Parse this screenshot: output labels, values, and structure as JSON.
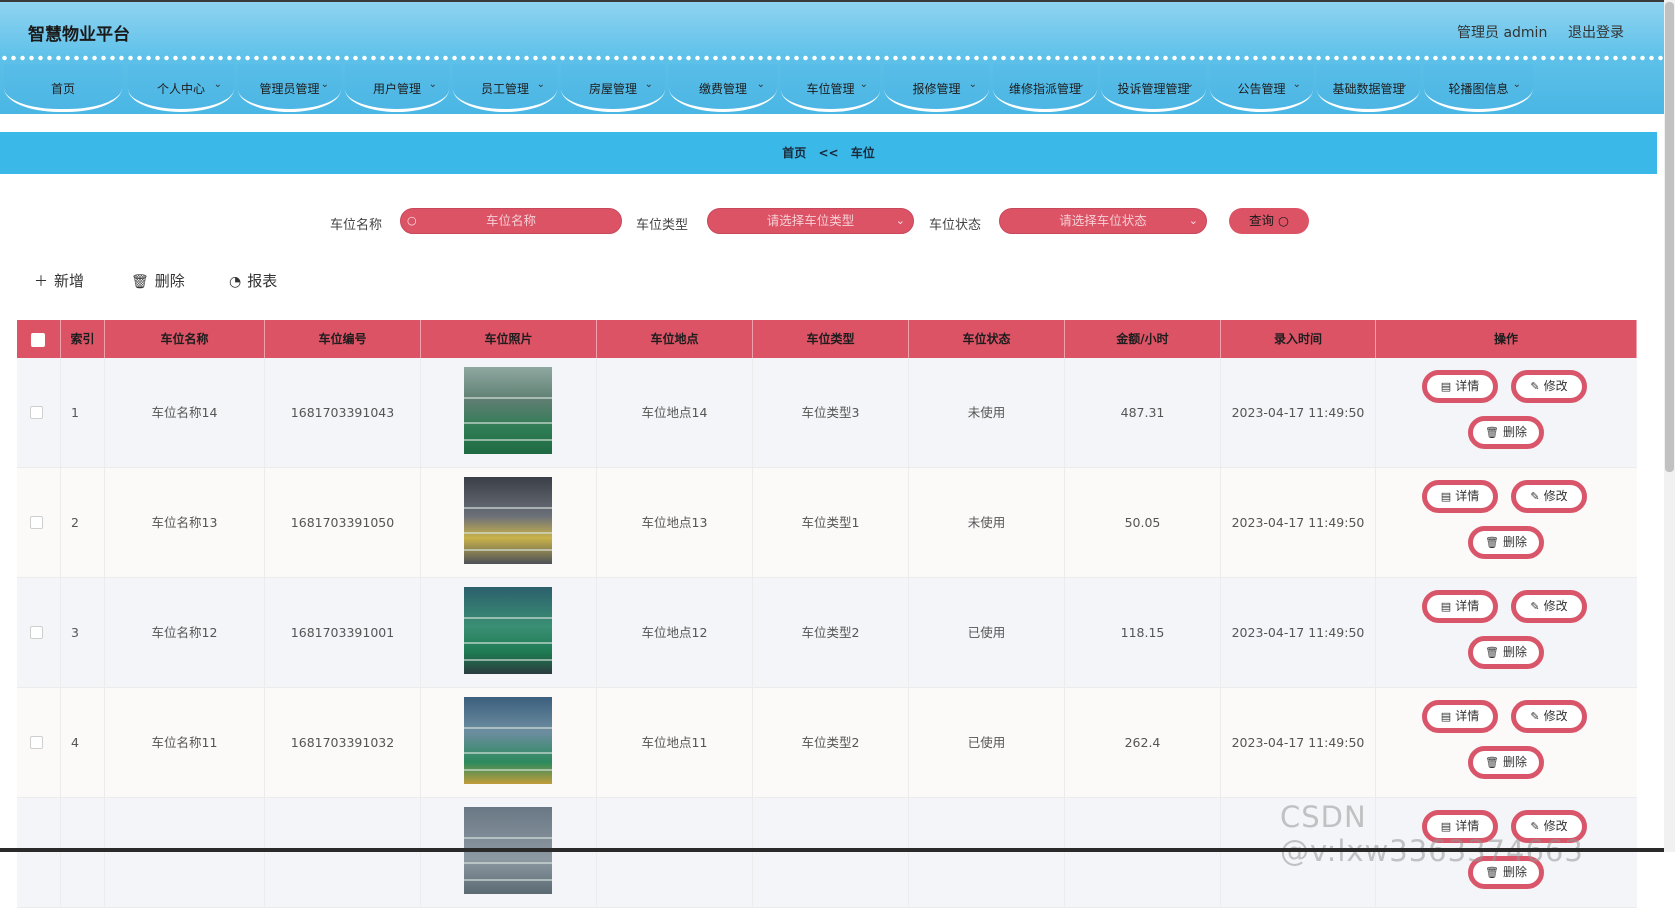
{
  "header": {
    "title": "智慧物业平台",
    "user_info": "管理员 admin",
    "logout": "退出登录"
  },
  "nav": [
    {
      "label": "首页",
      "dropdown": false
    },
    {
      "label": "个人中心",
      "dropdown": true
    },
    {
      "label": "管理员管理",
      "dropdown": true
    },
    {
      "label": "用户管理",
      "dropdown": true
    },
    {
      "label": "员工管理",
      "dropdown": true
    },
    {
      "label": "房屋管理",
      "dropdown": true
    },
    {
      "label": "缴费管理",
      "dropdown": true
    },
    {
      "label": "车位管理",
      "dropdown": true
    },
    {
      "label": "报修管理",
      "dropdown": true
    },
    {
      "label": "维修指派管理",
      "dropdown": true
    },
    {
      "label": "投诉管理管理",
      "dropdown": true
    },
    {
      "label": "公告管理",
      "dropdown": true
    },
    {
      "label": "基础数据管理",
      "dropdown": true
    },
    {
      "label": "轮播图信息",
      "dropdown": true
    }
  ],
  "breadcrumb": {
    "home": "首页",
    "separator": "<<",
    "current": "车位"
  },
  "search": {
    "name_label": "车位名称",
    "name_placeholder": "车位名称",
    "type_label": "车位类型",
    "type_placeholder": "请选择车位类型",
    "status_label": "车位状态",
    "status_placeholder": "请选择车位状态",
    "query_label": "查询"
  },
  "toolbar": {
    "add": "新增",
    "delete": "删除",
    "report": "报表"
  },
  "table": {
    "columns": [
      "索引",
      "车位名称",
      "车位编号",
      "车位照片",
      "车位地点",
      "车位类型",
      "车位状态",
      "金额/小时",
      "录入时间",
      "操作"
    ],
    "rows": [
      {
        "index": "1",
        "name": "车位名称14",
        "code": "1681703391043",
        "location": "车位地点14",
        "type": "车位类型3",
        "status": "未使用",
        "price": "487.31",
        "time": "2023-04-17 11:49:50"
      },
      {
        "index": "2",
        "name": "车位名称13",
        "code": "1681703391050",
        "location": "车位地点13",
        "type": "车位类型1",
        "status": "未使用",
        "price": "50.05",
        "time": "2023-04-17 11:49:50"
      },
      {
        "index": "3",
        "name": "车位名称12",
        "code": "1681703391001",
        "location": "车位地点12",
        "type": "车位类型2",
        "status": "已使用",
        "price": "118.15",
        "time": "2023-04-17 11:49:50"
      },
      {
        "index": "4",
        "name": "车位名称11",
        "code": "1681703391032",
        "location": "车位地点11",
        "type": "车位类型2",
        "status": "已使用",
        "price": "262.4",
        "time": "2023-04-17 11:49:50"
      },
      {
        "index": "",
        "name": "",
        "code": "",
        "location": "",
        "type": "",
        "status": "",
        "price": "",
        "time": ""
      }
    ],
    "actions": {
      "detail": "详情",
      "edit": "修改",
      "delete": "删除"
    }
  },
  "watermark": "CSDN @v:lxw3363374663",
  "colors": {
    "header": "#5ec1e9",
    "accent": "#dc5366",
    "breadcrumb": "#3ab8e8"
  }
}
